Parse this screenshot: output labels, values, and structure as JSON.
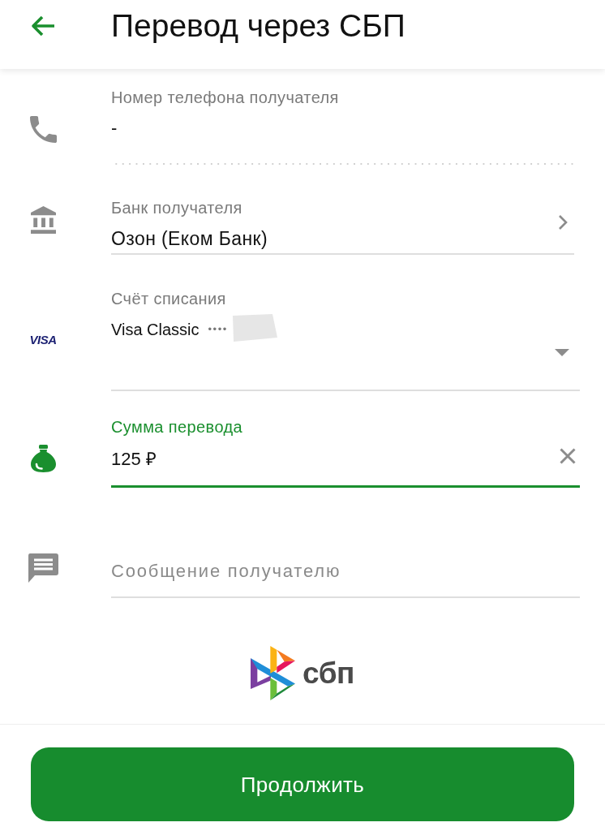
{
  "header": {
    "title": "Перевод через СБП"
  },
  "fields": [
    {
      "kind": "phone",
      "label": "Номер телефона получателя",
      "value": "-",
      "focused": false
    },
    {
      "kind": "bank",
      "label": "Банк получателя",
      "value": "Озон (Еком Банк)",
      "focused": false
    },
    {
      "kind": "account",
      "label": "Счёт списания",
      "card_brand": "VISA",
      "value": "Visa Classic",
      "masked_number": "••••",
      "focused": false
    },
    {
      "kind": "amount",
      "label": "Сумма перевода",
      "value": "125 ₽",
      "focused": true
    },
    {
      "kind": "message",
      "placeholder": "Сообщение получателю",
      "focused": false
    }
  ],
  "logo": {
    "text": "сбп"
  },
  "button": {
    "label": "Продолжить"
  }
}
